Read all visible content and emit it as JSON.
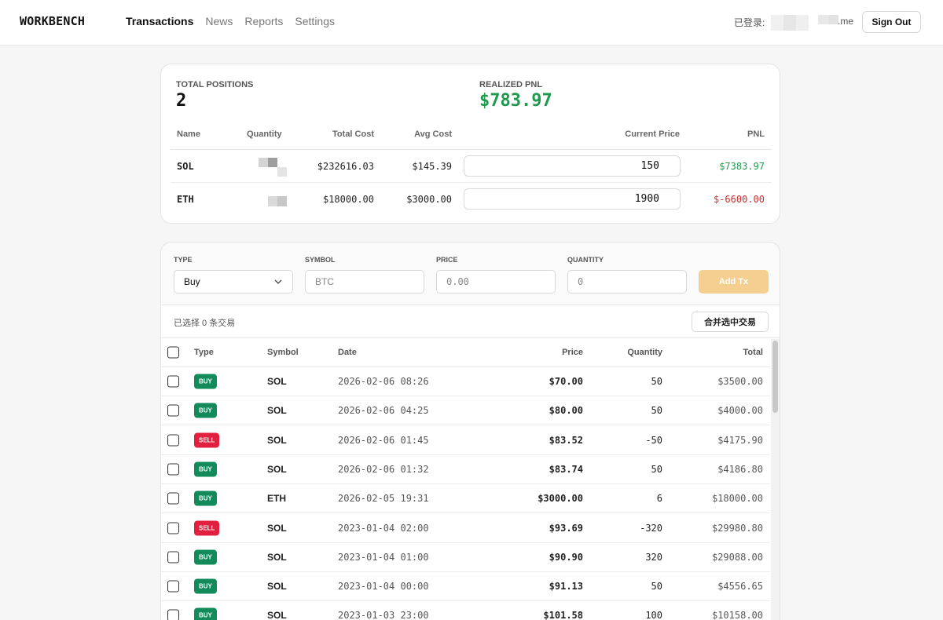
{
  "header": {
    "brand": "WORKBENCH",
    "nav": [
      "Transactions",
      "News",
      "Reports",
      "Settings"
    ],
    "active_nav": "Transactions",
    "login_label": "已登录:",
    "email_suffix": ".me",
    "sign_out": "Sign Out"
  },
  "summary": {
    "total_positions_label": "TOTAL POSITIONS",
    "total_positions": "2",
    "realized_pnl_label": "REALIZED PNL",
    "realized_pnl": "$783.97",
    "pnl_color": "#1e9a4c",
    "columns": [
      "Name",
      "Quantity",
      "Total Cost",
      "Avg Cost",
      "Current Price",
      "PNL"
    ],
    "rows": [
      {
        "name": "SOL",
        "total_cost": "$232616.03",
        "avg_cost": "$145.39",
        "current_price": "150",
        "pnl": "$7383.97",
        "pnl_color": "#1e9a4c"
      },
      {
        "name": "ETH",
        "total_cost": "$18000.00",
        "avg_cost": "$3000.00",
        "current_price": "1900",
        "pnl": "$-6600.00",
        "pnl_color": "#d12b2b"
      }
    ]
  },
  "form": {
    "type_label": "TYPE",
    "type_value": "Buy",
    "symbol_label": "SYMBOL",
    "symbol_placeholder": "BTC",
    "price_label": "PRICE",
    "price_placeholder": "0.00",
    "quantity_label": "QUANTITY",
    "quantity_placeholder": "0",
    "add_button": "Add Tx"
  },
  "selection": {
    "text": "已选择 0 条交易",
    "merge_button": "合并选中交易"
  },
  "transactions": {
    "columns": [
      "Type",
      "Symbol",
      "Date",
      "Price",
      "Quantity",
      "Total"
    ],
    "rows": [
      {
        "type": "BUY",
        "symbol": "SOL",
        "date": "2026-02-06 08:26",
        "price": "$70.00",
        "quantity": "50",
        "total": "$3500.00"
      },
      {
        "type": "BUY",
        "symbol": "SOL",
        "date": "2026-02-06 04:25",
        "price": "$80.00",
        "quantity": "50",
        "total": "$4000.00"
      },
      {
        "type": "SELL",
        "symbol": "SOL",
        "date": "2026-02-06 01:45",
        "price": "$83.52",
        "quantity": "-50",
        "total": "$4175.90"
      },
      {
        "type": "BUY",
        "symbol": "SOL",
        "date": "2026-02-06 01:32",
        "price": "$83.74",
        "quantity": "50",
        "total": "$4186.80"
      },
      {
        "type": "BUY",
        "symbol": "ETH",
        "date": "2026-02-05 19:31",
        "price": "$3000.00",
        "quantity": "6",
        "total": "$18000.00"
      },
      {
        "type": "SELL",
        "symbol": "SOL",
        "date": "2023-01-04 02:00",
        "price": "$93.69",
        "quantity": "-320",
        "total": "$29980.80"
      },
      {
        "type": "BUY",
        "symbol": "SOL",
        "date": "2023-01-04 01:00",
        "price": "$90.90",
        "quantity": "320",
        "total": "$29088.00"
      },
      {
        "type": "BUY",
        "symbol": "SOL",
        "date": "2023-01-04 00:00",
        "price": "$91.13",
        "quantity": "50",
        "total": "$4556.65"
      },
      {
        "type": "BUY",
        "symbol": "SOL",
        "date": "2023-01-03 23:00",
        "price": "$101.58",
        "quantity": "100",
        "total": "$10158.00"
      }
    ]
  }
}
